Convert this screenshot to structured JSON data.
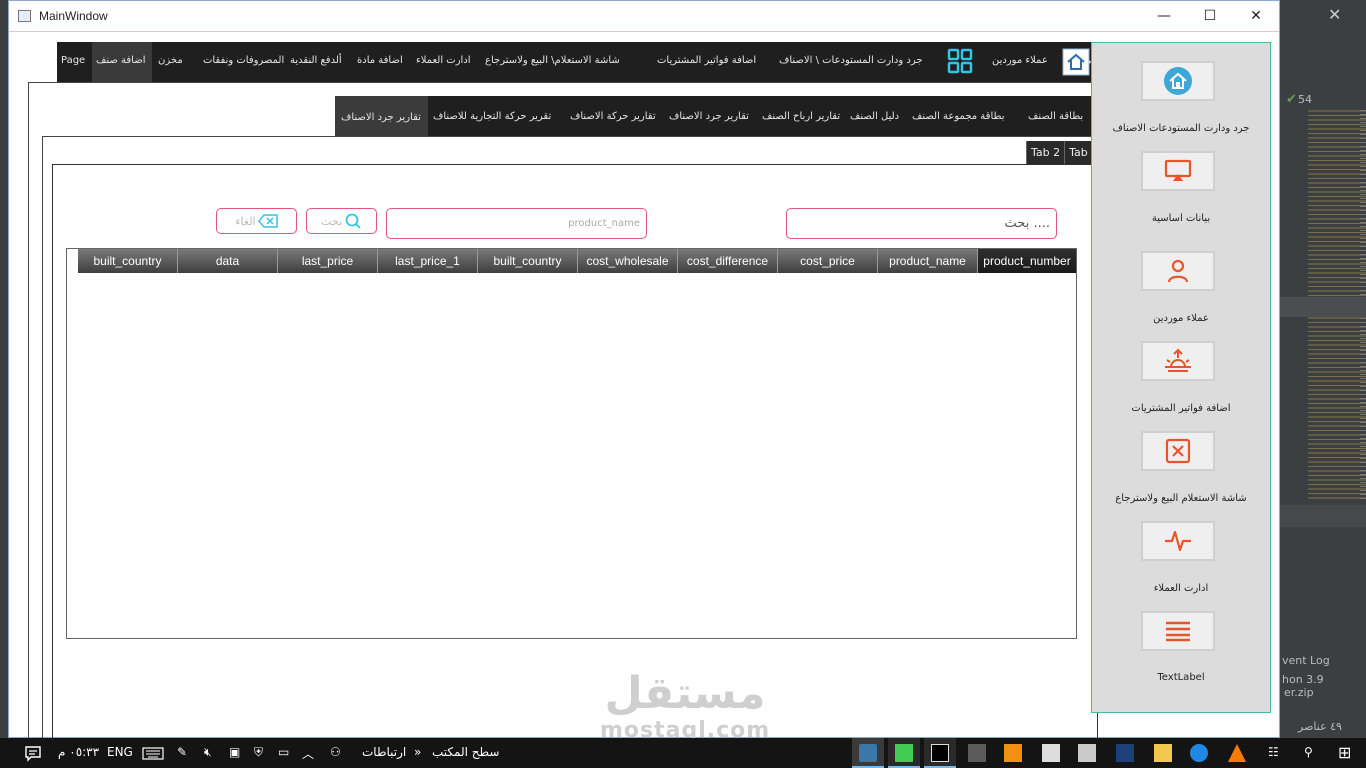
{
  "window": {
    "title": "MainWindow"
  },
  "menu": {
    "items": [
      "عملاء موردين",
      "جرد ودارت المستودعات \\ الاصناف",
      "اضافة فواتير المشتريات",
      "شاشة الاستعلام\\ البيع ولاسترجاع",
      "ادارت العملاء",
      "اضافة مادة",
      "ألدفع النقدية",
      "المصروفات ونفقات",
      "مخزن",
      "اضافة صنف",
      "Page"
    ]
  },
  "subtabs": {
    "items": [
      "بطاقة الصنف",
      "بطاقة مجموعة الصنف",
      "دليل الصنف",
      "تقارير ارباح الصنف",
      "تقارير جرد الاصناف",
      "تقارير حركة الاصناف",
      "تقرير حركة التجارية للاصناف",
      "تقارير جرد الاصناف"
    ]
  },
  "inner_tabs": [
    "Tab 2",
    "Tab 1"
  ],
  "search": {
    "placeholder": "بحث ....",
    "product_placeholder": "product_name",
    "search_button": "بحث",
    "cancel_button": "الغاء"
  },
  "table": {
    "columns": [
      "built_country",
      "data",
      "last_price",
      "last_price_1",
      "built_country",
      "cost_wholesale",
      "cost_difference",
      "cost_price",
      "product_name",
      "product_number"
    ],
    "rows": []
  },
  "sidebar": {
    "items": [
      {
        "label": "جرد ودارت المستودعات   الاصناف",
        "icon": "home-icon"
      },
      {
        "label": "بيانات اساسية",
        "icon": "monitor-icon"
      },
      {
        "label": "عملاء موردين",
        "icon": "user-icon"
      },
      {
        "label": "اضافة فواتير المشتريات",
        "icon": "sunrise-icon"
      },
      {
        "label": "شاشة الاستعلام  البيع ولاسترجاع",
        "icon": "close-box-icon"
      },
      {
        "label": "ادارت العملاء",
        "icon": "activity-icon"
      },
      {
        "label": "TextLabel",
        "icon": "menu-icon"
      }
    ]
  },
  "watermark": {
    "arabic": "مستقل",
    "latin": "mostaql.com"
  },
  "background_ide": {
    "count": "54",
    "event_log": "vent Log",
    "python": "hon 3.9",
    "zip": "er.zip",
    "items": "٤٩ عناصر"
  },
  "taskbar": {
    "time": "٠٥:٣٣ م",
    "lang": "ENG",
    "connections": "ارتباطات",
    "desktop": "سطح المكتب"
  },
  "colors": {
    "accent_pink": "#e0577e",
    "icon_orange": "#e8542b",
    "panel_border": "#48b9a8",
    "grid_cyan": "#37c3e6"
  }
}
